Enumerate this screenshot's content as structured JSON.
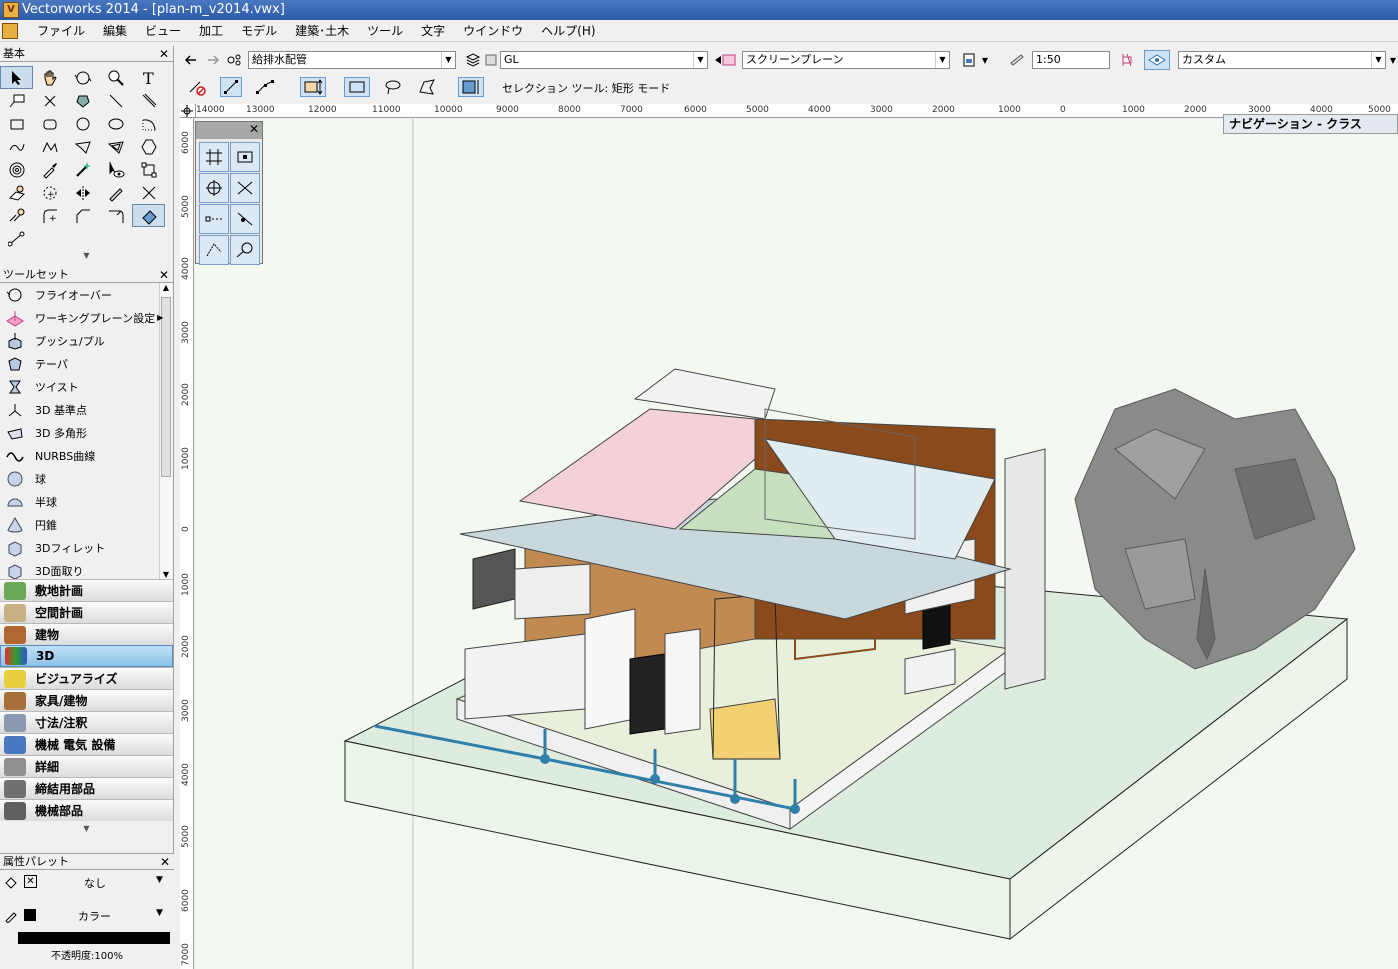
{
  "window": {
    "title": "Vectorworks 2014 - [plan-m_v2014.vwx]"
  },
  "menu": [
    "ファイル",
    "編集",
    "ビュー",
    "加工",
    "モデル",
    "建築･土木",
    "ツール",
    "文字",
    "ウインドウ",
    "ヘルプ(H)"
  ],
  "basic_palette": {
    "title": "基本"
  },
  "toolset_palette": {
    "title": "ツールセット",
    "tools": [
      "フライオーバー",
      "ワーキングプレーン設定",
      "プッシュ/プル",
      "テーパ",
      "ツイスト",
      "3D 基準点",
      "3D 多角形",
      "NURBS曲線",
      "球",
      "半球",
      "円錐",
      "3Dフィレット",
      "3D面取り"
    ],
    "categories": [
      "敷地計画",
      "空間計画",
      "建物",
      "3D",
      "ビジュアライズ",
      "家具/建物",
      "寸法/注釈",
      "機械 電気 設備",
      "詳細",
      "締結用部品",
      "機械部品"
    ],
    "active_category": "3D"
  },
  "attribute_palette": {
    "title": "属性パレット",
    "fill": "なし",
    "pen": "カラー",
    "opacity": "不透明度:100%"
  },
  "view_bar": {
    "class": "給排水配管",
    "layer": "GL",
    "plane": "スクリーンプレーン",
    "scale": "1:50",
    "view": "カスタム"
  },
  "mode_bar": {
    "status": "セレクション ツール: 矩形 モード"
  },
  "ruler": {
    "top": [
      "14000",
      "13000",
      "12000",
      "11000",
      "10000",
      "9000",
      "8000",
      "7000",
      "6000",
      "5000",
      "4000",
      "3000",
      "2000",
      "1000",
      "0",
      "1000",
      "2000",
      "3000",
      "4000",
      "5000"
    ],
    "left": [
      "6000",
      "5000",
      "4000",
      "3000",
      "2000",
      "1000",
      "0",
      "1000",
      "2000",
      "3000",
      "4000",
      "5000",
      "6000",
      "7000"
    ]
  },
  "navigation": {
    "title": "ナビゲーション - クラス"
  },
  "colors": {
    "accent": "#3a6cc0",
    "canvas": "#f3f9f0",
    "pipe": "#2f7fa8"
  }
}
